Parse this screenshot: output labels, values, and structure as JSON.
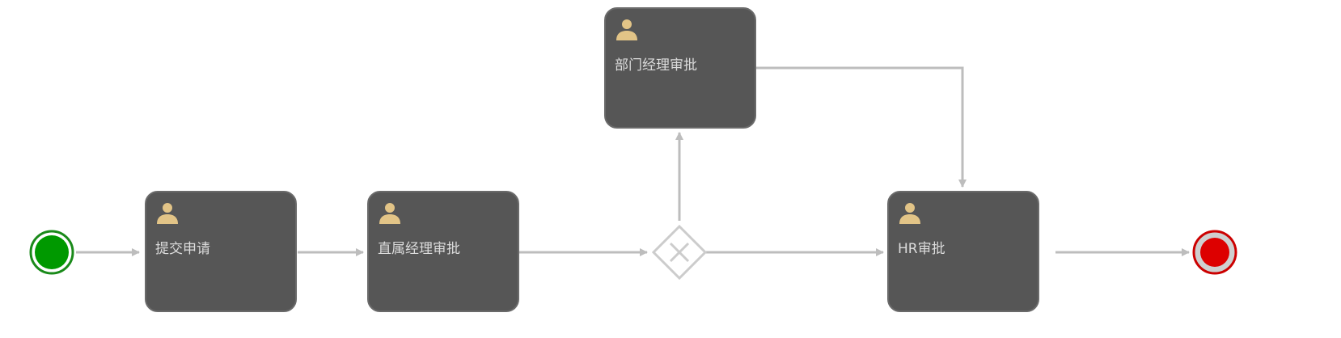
{
  "diagram": {
    "tasks": [
      {
        "id": "submit",
        "label": "提交申请",
        "icon": "user-icon"
      },
      {
        "id": "direct",
        "label": "直属经理审批",
        "icon": "user-icon"
      },
      {
        "id": "dept",
        "label": "部门经理审批",
        "icon": "user-icon"
      },
      {
        "id": "hr",
        "label": "HR审批",
        "icon": "user-icon"
      }
    ],
    "events": {
      "start": {
        "type": "start-event",
        "fill": "#009900",
        "stroke": "#1a8a1a"
      },
      "end": {
        "type": "end-event",
        "fill": "#dd0000",
        "stroke": "#cc0000"
      }
    },
    "gateway": {
      "type": "exclusive-gateway",
      "icon": "x-icon"
    },
    "colors": {
      "task_fill": "#565656",
      "task_text": "#dcdcdc",
      "user_icon": "#e2c487",
      "flow": "#bdbdbd",
      "gateway_stroke": "#cccccc"
    }
  }
}
